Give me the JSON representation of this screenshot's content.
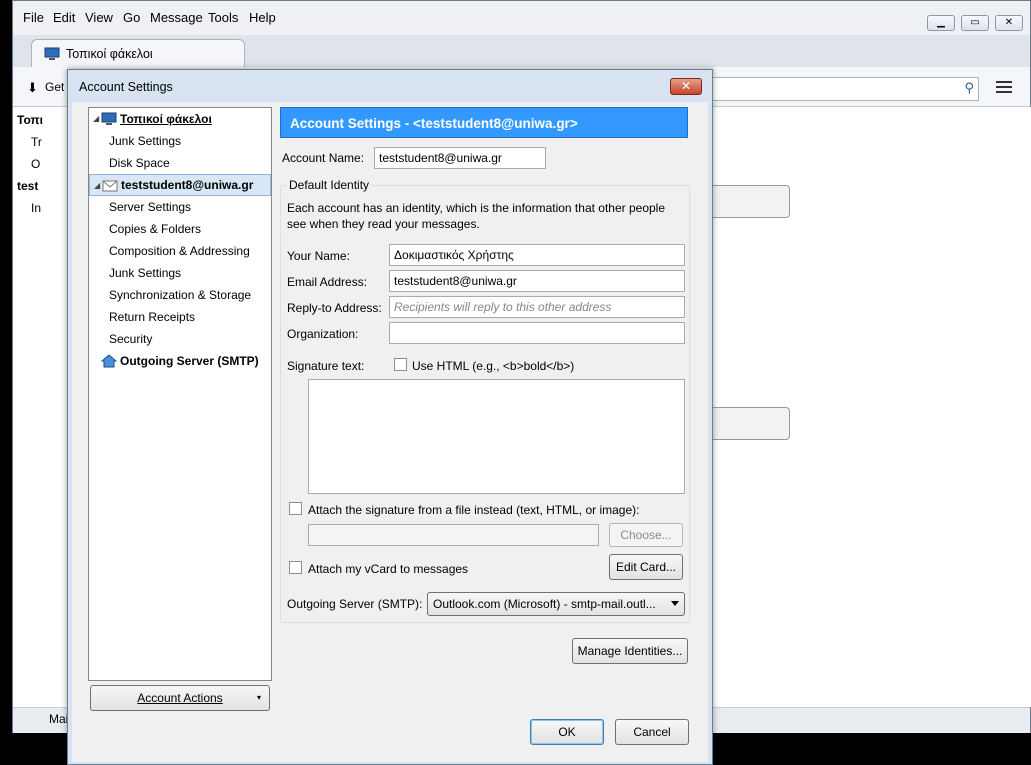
{
  "app": {
    "menu": [
      "File",
      "Edit",
      "View",
      "Go",
      "Message",
      "Tools",
      "Help"
    ],
    "tab_label": "Τοπικοί φάκελοι",
    "toolbar_get": "Get",
    "folder_rows": [
      "Τοπι",
      "Tr",
      "O",
      "test",
      "In"
    ],
    "status_text": "Mai"
  },
  "dialog": {
    "title": "Account Settings",
    "close_glyph": "✕",
    "tree": {
      "local_folders": "Τοπικοί φάκελοι",
      "local_children": [
        "Junk Settings",
        "Disk Space"
      ],
      "account": "teststudent8@uniwa.gr",
      "account_children": [
        "Server Settings",
        "Copies & Folders",
        "Composition & Addressing",
        "Junk Settings",
        "Synchronization & Storage",
        "Return Receipts",
        "Security"
      ],
      "outgoing": "Outgoing Server (SMTP)"
    },
    "account_actions_label": "Account Actions",
    "banner": "Account Settings - <teststudent8@uniwa.gr>",
    "account_name_label": "Account Name:",
    "account_name_value": "teststudent8@uniwa.gr",
    "default_identity_legend": "Default Identity",
    "identity_desc": "Each account has an identity, which is the information that other people see when they read your messages.",
    "your_name_label": "Your Name:",
    "your_name_value": "Δοκιμαστικός Χρήστης",
    "email_label": "Email Address:",
    "email_value": "teststudent8@uniwa.gr",
    "replyto_label": "Reply-to Address:",
    "replyto_placeholder": "Recipients will reply to this other address",
    "org_label": "Organization:",
    "org_value": "",
    "sig_label": "Signature text:",
    "use_html_label": "Use HTML (e.g., <b>bold</b>)",
    "attach_sig_label": "Attach the signature from a file instead (text, HTML, or image):",
    "choose_label": "Choose...",
    "attach_vcard_label": "Attach my vCard to messages",
    "edit_card_label": "Edit Card...",
    "outgoing_label": "Outgoing Server (SMTP):",
    "outgoing_value": "Outlook.com (Microsoft) - smtp-mail.outl...",
    "manage_identities_label": "Manage Identities...",
    "ok_label": "OK",
    "cancel_label": "Cancel"
  },
  "colors": {
    "banner": "#3399ff",
    "selection": "#d9e6f5",
    "dialog_frame": "#d7e3f1"
  }
}
